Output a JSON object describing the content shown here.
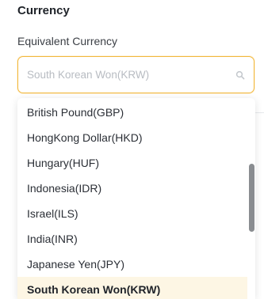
{
  "section": {
    "title": "Currency"
  },
  "field": {
    "label": "Equivalent Currency",
    "value": "",
    "placeholder": "South Korean Won(KRW)",
    "icon": "search-icon"
  },
  "dropdown": {
    "selected": "South Korean Won(KRW)",
    "options": [
      {
        "label": "British Pound(GBP)"
      },
      {
        "label": "HongKong Dollar(HKD)"
      },
      {
        "label": "Hungary(HUF)"
      },
      {
        "label": "Indonesia(IDR)"
      },
      {
        "label": "Israel(ILS)"
      },
      {
        "label": "India(INR)"
      },
      {
        "label": "Japanese Yen(JPY)"
      },
      {
        "label": "South Korean Won(KRW)"
      }
    ]
  },
  "colors": {
    "accent_border": "#f2b83c",
    "selected_background": "#fdf6e4",
    "scrollbar_thumb": "#8a8d91"
  }
}
